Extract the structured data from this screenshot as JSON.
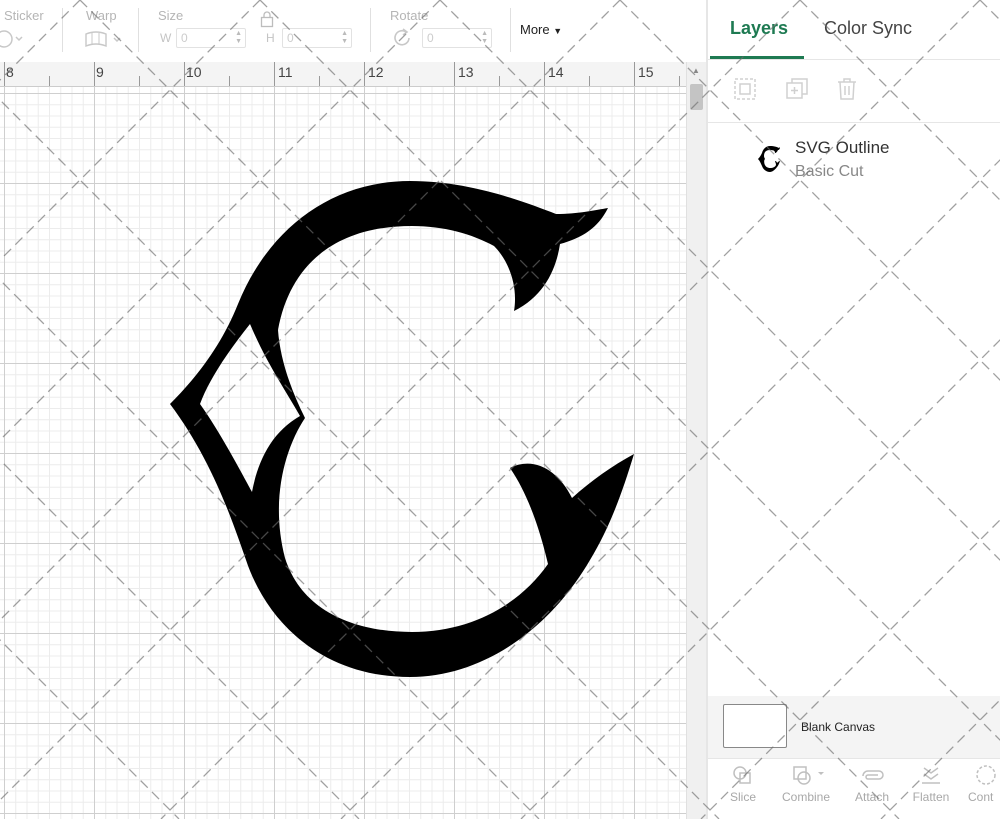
{
  "toolbar": {
    "sticker_label": "Sticker",
    "warp_label": "Warp",
    "size_label": "Size",
    "width_letter": "W",
    "width_value": "0",
    "height_letter": "H",
    "height_value": "0",
    "rotate_label": "Rotate",
    "rotate_value": "0",
    "more_label": "More"
  },
  "ruler": {
    "numbers": [
      "8",
      "9",
      "10",
      "11",
      "12",
      "13",
      "14",
      "15"
    ]
  },
  "panel": {
    "tabs": [
      {
        "label": "Layers",
        "active": true
      },
      {
        "label": "Color Sync",
        "active": false
      }
    ],
    "layer": {
      "name": "SVG Outline",
      "operation": "Basic Cut"
    },
    "blank_canvas_label": "Blank Canvas",
    "bottom_tools": [
      {
        "label": "Slice",
        "icon": "slice-icon"
      },
      {
        "label": "Combine",
        "icon": "combine-icon"
      },
      {
        "label": "Attach",
        "icon": "attach-icon"
      },
      {
        "label": "Flatten",
        "icon": "flatten-icon"
      },
      {
        "label": "Cont",
        "icon": "contour-icon"
      }
    ]
  },
  "colors": {
    "accent": "#1e7a52",
    "shape_fill": "#000000",
    "grid_major": "#cfcfcf",
    "grid_minor": "#ececec"
  }
}
